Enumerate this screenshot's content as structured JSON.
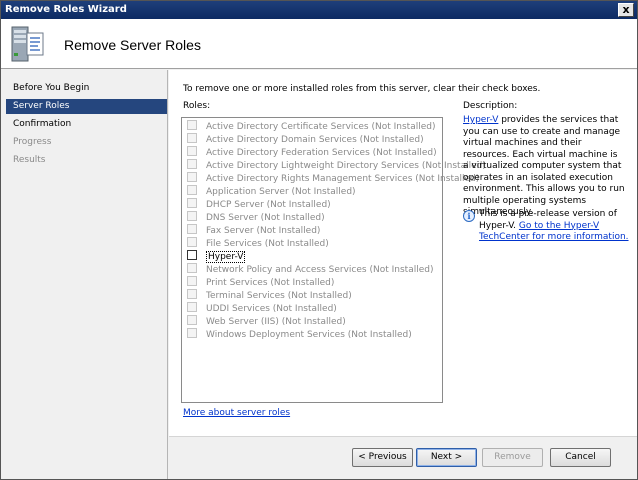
{
  "window": {
    "title": "Remove Roles Wizard",
    "close_label": "x"
  },
  "header": {
    "title": "Remove Server Roles",
    "icon": "server-wizard-icon"
  },
  "sidebar": {
    "items": [
      {
        "label": "Before You Begin",
        "state": "normal"
      },
      {
        "label": "Server Roles",
        "state": "active"
      },
      {
        "label": "Confirmation",
        "state": "normal"
      },
      {
        "label": "Progress",
        "state": "disabled"
      },
      {
        "label": "Results",
        "state": "disabled"
      }
    ]
  },
  "main": {
    "intro": "To remove one or more installed roles from this server, clear their check boxes.",
    "roles_label": "Roles:",
    "roles": [
      {
        "name": "Active Directory Certificate Services",
        "status": "(Not Installed)",
        "enabled": false
      },
      {
        "name": "Active Directory Domain Services",
        "status": "(Not Installed)",
        "enabled": false
      },
      {
        "name": "Active Directory Federation Services",
        "status": "(Not Installed)",
        "enabled": false
      },
      {
        "name": "Active Directory Lightweight Directory Services",
        "status": "(Not Installed)",
        "enabled": false
      },
      {
        "name": "Active Directory Rights Management Services",
        "status": "(Not Installed)",
        "enabled": false
      },
      {
        "name": "Application Server",
        "status": "(Not Installed)",
        "enabled": false
      },
      {
        "name": "DHCP Server",
        "status": "(Not Installed)",
        "enabled": false
      },
      {
        "name": "DNS Server",
        "status": "(Not Installed)",
        "enabled": false
      },
      {
        "name": "Fax Server",
        "status": "(Not Installed)",
        "enabled": false
      },
      {
        "name": "File Services",
        "status": "(Not Installed)",
        "enabled": false
      },
      {
        "name": "Hyper-V",
        "status": "",
        "enabled": true
      },
      {
        "name": "Network Policy and Access Services",
        "status": "(Not Installed)",
        "enabled": false
      },
      {
        "name": "Print Services",
        "status": "(Not Installed)",
        "enabled": false
      },
      {
        "name": "Terminal Services",
        "status": "(Not Installed)",
        "enabled": false
      },
      {
        "name": "UDDI Services",
        "status": "(Not Installed)",
        "enabled": false
      },
      {
        "name": "Web Server (IIS)",
        "status": "(Not Installed)",
        "enabled": false
      },
      {
        "name": "Windows Deployment Services",
        "status": "(Not Installed)",
        "enabled": false
      }
    ],
    "description_label": "Description:",
    "description_link": "Hyper-V",
    "description_text": " provides the services that you can use to create and manage virtual machines and their resources. Each virtual machine is a virtualized computer system that operates in an isolated execution environment. This allows you to run multiple operating systems simultaneously.",
    "info_text": "This is a pre-release version of Hyper-V. ",
    "info_link": "Go to the Hyper-V TechCenter for more information.",
    "info_icon_glyph": "i",
    "more_link": "More about server roles"
  },
  "buttons": {
    "previous": "< Previous",
    "next": "Next >",
    "remove": "Remove",
    "cancel": "Cancel"
  }
}
